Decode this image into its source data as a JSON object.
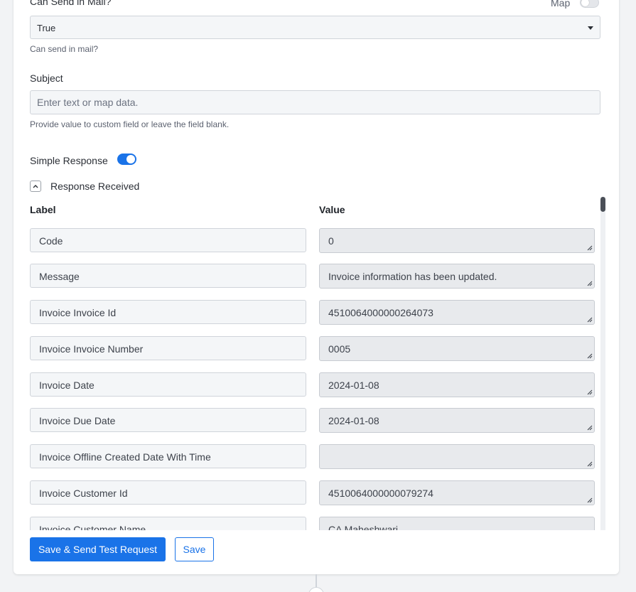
{
  "send_in_mail": {
    "title": "Can Send in Mail?",
    "selected_value": "True",
    "help": "Can send in mail?",
    "map_label": "Map"
  },
  "subject": {
    "label": "Subject",
    "placeholder": "Enter text or map data.",
    "help": "Provide value to custom field or leave the field blank."
  },
  "simple_response": {
    "label": "Simple Response",
    "enabled": true
  },
  "response_received": {
    "title": "Response Received",
    "column_label": "Label",
    "column_value": "Value",
    "rows": [
      {
        "label": "Code",
        "value": "0"
      },
      {
        "label": "Message",
        "value": "Invoice information has been updated."
      },
      {
        "label": "Invoice Invoice Id",
        "value": "4510064000000264073"
      },
      {
        "label": "Invoice Invoice Number",
        "value": "0005"
      },
      {
        "label": "Invoice Date",
        "value": "2024-01-08"
      },
      {
        "label": "Invoice Due Date",
        "value": "2024-01-08"
      },
      {
        "label": "Invoice Offline Created Date With Time",
        "value": ""
      },
      {
        "label": "Invoice Customer Id",
        "value": "4510064000000079274"
      },
      {
        "label": "Invoice Customer Name",
        "value": "CA Maheshwari"
      }
    ]
  },
  "actions": {
    "save_send_label": "Save & Send Test Request",
    "save_label": "Save"
  },
  "colors": {
    "accent": "#1a73e8",
    "input_bg": "#f4f6f8",
    "value_bg": "#e8eaed"
  }
}
